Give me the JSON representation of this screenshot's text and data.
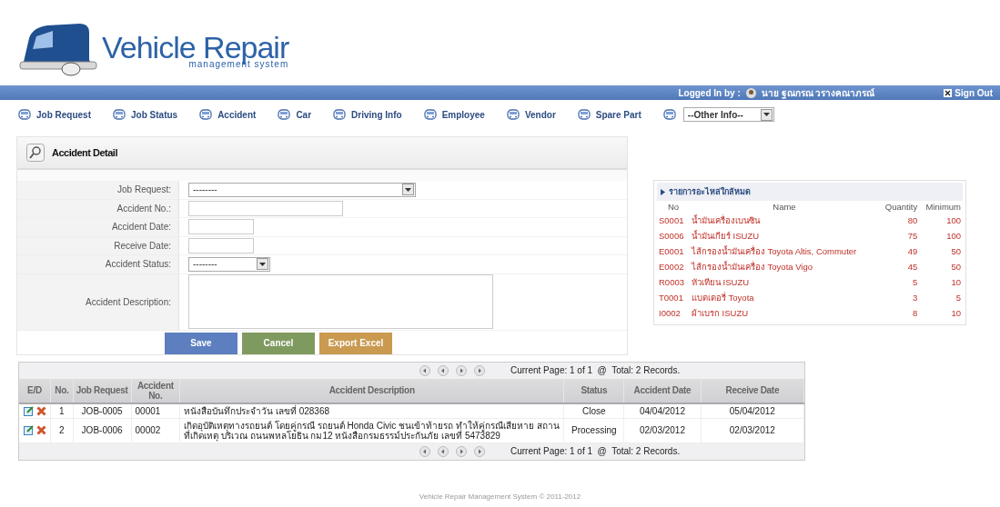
{
  "logo": {
    "title": "Vehicle Repair",
    "subtitle": "management system"
  },
  "top_bar": {
    "logged_label": "Logged In by :",
    "user": "นาย ฐณกรณ วรางคณาภรณ์",
    "sign_out": "Sign Out"
  },
  "nav": {
    "items": [
      "Job Request",
      "Job Status",
      "Accident",
      "Car",
      "Driving Info",
      "Employee",
      "Vendor",
      "Spare Part"
    ],
    "other_select": "--Other Info--"
  },
  "form": {
    "title": "Accident Detail",
    "fields": [
      {
        "kind": "select",
        "label": "Job Request:",
        "value": "--------"
      },
      {
        "kind": "text",
        "label": "Accident No.:"
      },
      {
        "kind": "text",
        "label": "Accident Date:"
      },
      {
        "kind": "text",
        "label": "Receive Date:"
      },
      {
        "kind": "select",
        "label": "Accident Status:",
        "value": "--------"
      },
      {
        "kind": "textarea",
        "label": "Accident Description:"
      }
    ],
    "buttons": [
      {
        "label": "Save",
        "color": "#5d7fbf"
      },
      {
        "label": "Cancel",
        "color": "#7f9a5f"
      },
      {
        "label": "Export Excel",
        "color": "#c99a50"
      }
    ]
  },
  "parts": {
    "title": "รายการอะไหล่ใกล้หมด",
    "columns": [
      "No",
      "Name",
      "Quantity",
      "Minimum"
    ],
    "rows": [
      [
        "S0001",
        "น้ำมันเครื่องเบนซิน",
        "80",
        "100"
      ],
      [
        "S0006",
        "น้ำมันเกียร์ ISUZU",
        "75",
        "100"
      ],
      [
        "E0001",
        "ไส้กรองน้ำมันเครื่อง Toyota Altis, Commuter",
        "49",
        "50"
      ],
      [
        "E0002",
        "ไส้กรองน้ำมันเครื่อง Toyota Vigo",
        "45",
        "50"
      ],
      [
        "R0003",
        "หัวเทียน ISUZU",
        "5",
        "10"
      ],
      [
        "T0001",
        "แบตเตอรี่ Toyota",
        "3",
        "5"
      ],
      [
        "I0002",
        "ผ้าเบรก ISUZU",
        "8",
        "10"
      ]
    ]
  },
  "table": {
    "pager_top": "Current Page: 1 of 1  @  Total: 2 Records.",
    "columns": [
      "E/D",
      "No.",
      "Job Request",
      "Accident No.",
      "Accident Description",
      "Status",
      "Accident Date",
      "Receive Date"
    ],
    "rows": [
      {
        "no": "1",
        "job_request": "JOB-0005",
        "accident_no": "00001",
        "description": "หนังสือบันทึกประจำวัน เลขที่ 028368",
        "status": "Close",
        "accident_date": "04/04/2012",
        "receive_date": "05/04/2012"
      },
      {
        "no": "2",
        "job_request": "JOB-0006",
        "accident_no": "00002",
        "description": "เกิดอุบัติเหตุทางรถยนต์ โดยคู่กรณี รถยนต์ Honda Civic ชนเข้าท้ายรถ ทำให้คู่กรณีเสียหาย สถานที่เกิดเหตุ บริเวณ ถนนพหลโยธิน กม12 หนังสือกรมธรรม์ประกันภัย เลขที่ 5473829",
        "status": "Processing",
        "accident_date": "02/03/2012",
        "receive_date": "02/03/2012"
      }
    ],
    "pager_bottom": "Current Page: 1 of 1  @  Total: 2 Records."
  },
  "footer": "Vehicle Repair Management System © 2011-2012"
}
